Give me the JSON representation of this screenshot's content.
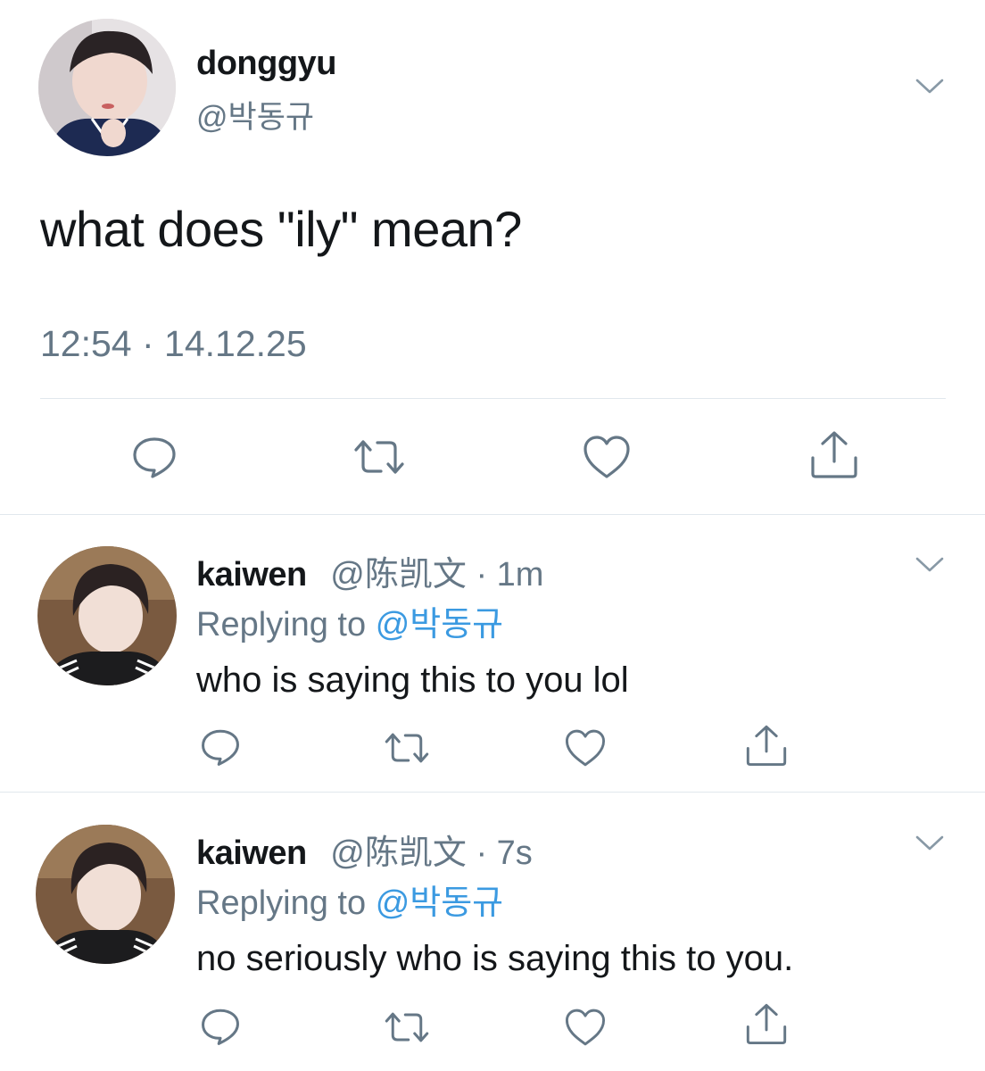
{
  "main_tweet": {
    "name": "donggyu",
    "handle": "@박동규",
    "text": "what does \"ily\" mean?",
    "timestamp": "12:54 · 14.12.25",
    "actions": [
      "reply-icon",
      "retweet-icon",
      "like-icon",
      "share-icon"
    ]
  },
  "replies": [
    {
      "name": "kaiwen",
      "handle": "@陈凯文",
      "time": "· 1m",
      "replying_label": "Replying to",
      "replying_handle": "@박동규",
      "text": "who is saying this to you lol"
    },
    {
      "name": "kaiwen",
      "handle": "@陈凯文",
      "time": "· 7s",
      "replying_label": "Replying to",
      "replying_handle": "@박동규",
      "text": "no seriously who is saying this to you."
    }
  ],
  "colors": {
    "icon_gray": "#657786",
    "link_blue": "#3b9ae1",
    "divider": "#e1e8ed"
  }
}
